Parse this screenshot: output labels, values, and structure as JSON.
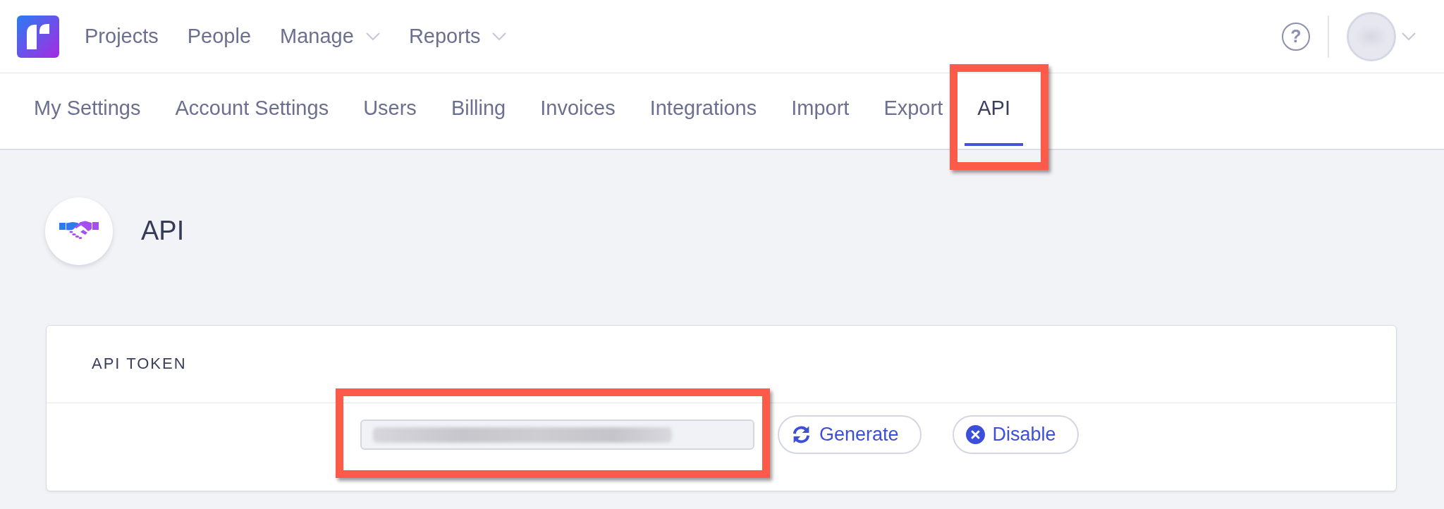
{
  "top_nav": {
    "items": [
      {
        "label": "Projects",
        "dropdown": false
      },
      {
        "label": "People",
        "dropdown": false
      },
      {
        "label": "Manage",
        "dropdown": true
      },
      {
        "label": "Reports",
        "dropdown": true
      }
    ],
    "help_button": {
      "label": "?"
    }
  },
  "settings_tabs": [
    {
      "label": "My Settings",
      "selected": false,
      "highlighted": false
    },
    {
      "label": "Account Settings",
      "selected": false,
      "highlighted": false
    },
    {
      "label": "Users",
      "selected": false,
      "highlighted": false
    },
    {
      "label": "Billing",
      "selected": false,
      "highlighted": false
    },
    {
      "label": "Invoices",
      "selected": false,
      "highlighted": false
    },
    {
      "label": "Integrations",
      "selected": false,
      "highlighted": false
    },
    {
      "label": "Import",
      "selected": false,
      "highlighted": false
    },
    {
      "label": "Export",
      "selected": false,
      "highlighted": false
    },
    {
      "label": "API",
      "selected": true,
      "highlighted": true
    }
  ],
  "page_header": {
    "title": "API"
  },
  "api_token": {
    "heading": "API TOKEN",
    "token_field": {
      "redacted": true,
      "highlighted": true
    },
    "buttons": [
      {
        "kind": "generate",
        "label": "Generate"
      },
      {
        "kind": "disable",
        "label": "Disable"
      }
    ]
  }
}
